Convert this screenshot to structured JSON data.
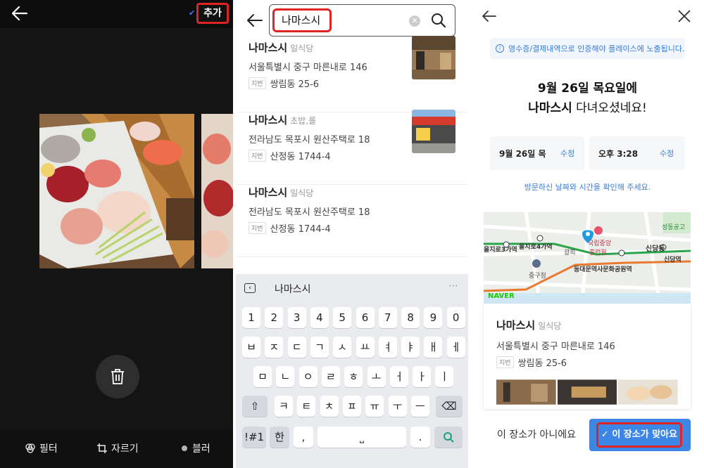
{
  "editor": {
    "add_label": "추가",
    "tools": [
      {
        "icon": "filter-icon",
        "label": "필터"
      },
      {
        "icon": "crop-icon",
        "label": "자르기"
      },
      {
        "icon": "blur-icon",
        "label": "블러"
      }
    ]
  },
  "search": {
    "query": "나마스시",
    "results": [
      {
        "name": "나마스시",
        "category": "일식당",
        "address": "서울특별시 중구 마른내로 146",
        "jibun_badge": "지번",
        "jibun": "쌍림동 25-6",
        "has_thumb": true
      },
      {
        "name": "나마스시",
        "category": "초밥,롤",
        "address": "전라남도 목포시 원산주택로 18",
        "jibun_badge": "지번",
        "jibun": "산정동 1744-4",
        "has_thumb": true
      },
      {
        "name": "나마스시",
        "category": "일식당",
        "address": "전라남도 목포시 원산주택로 18",
        "jibun_badge": "지번",
        "jibun": "산정동 1744-4",
        "has_thumb": false
      }
    ]
  },
  "keyboard": {
    "suggestion": "나마스시",
    "row1": [
      "1",
      "2",
      "3",
      "4",
      "5",
      "6",
      "7",
      "8",
      "9",
      "0"
    ],
    "row2": [
      "ㅂ",
      "ㅈ",
      "ㄷ",
      "ㄱ",
      "ㅅ",
      "ㅛ",
      "ㅕ",
      "ㅑ",
      "ㅐ",
      "ㅔ"
    ],
    "row3": [
      "ㅁ",
      "ㄴ",
      "ㅇ",
      "ㄹ",
      "ㅎ",
      "ㅗ",
      "ㅓ",
      "ㅏ",
      "ㅣ"
    ],
    "row4": [
      "ㅋ",
      "ㅌ",
      "ㅊ",
      "ㅍ",
      "ㅠ",
      "ㅜ",
      "ㅡ"
    ],
    "symbols_key": "!#1",
    "lang_key": "한",
    "comma_key": ",",
    "period_key": "."
  },
  "confirm": {
    "notice": "영수증/결제내역으로 인증해야 플레이스에 노출됩니다.",
    "headline_line1": "9월 26일 목요일에",
    "headline_place": "나마스시",
    "headline_rest": " 다녀오셨네요!",
    "date_value": "9월 26일 목",
    "time_value": "오후 3:28",
    "edit_label": "수정",
    "confirm_note": "방문하신 날짜와 시간을 확인해 주세요.",
    "map_labels": [
      "을지로4가역",
      "을지로3가역",
      "신당동",
      "중구청",
      "동대문역사문화공원역",
      "신당역",
      "광희",
      "훈련원",
      "국립중앙",
      "성동공고",
      "NAVER"
    ],
    "place": {
      "name": "나마스시",
      "category": "일식당",
      "address": "서울특별시 중구 마른내로 146",
      "jibun_badge": "지번",
      "jibun": "쌍림동 25-6"
    },
    "btn_no": "이 장소가 아니에요",
    "btn_yes": "이 장소가 맞아요"
  }
}
